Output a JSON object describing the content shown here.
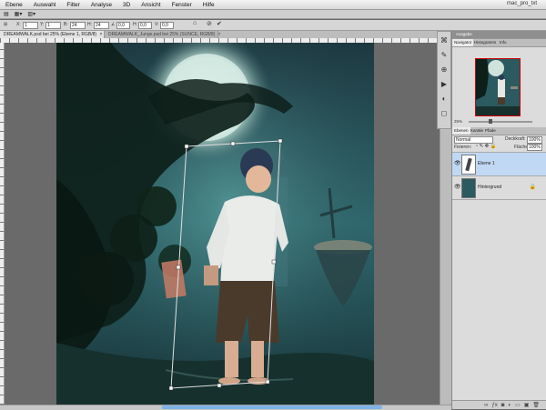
{
  "menu": {
    "items": [
      "Ebene",
      "Auswahl",
      "Filter",
      "Analyse",
      "3D",
      "Ansicht",
      "Fenster",
      "Hilfe"
    ],
    "workspace": "mac_pro_txt"
  },
  "options": {
    "field_w": "24",
    "field_h": "0,0",
    "field_x": "1",
    "field_angle": "0,0"
  },
  "tabs": [
    {
      "label": "DREAMWALK.psd bei 25% (Ebene 1, RGB/8)",
      "close": "×"
    },
    {
      "label": "DREAMWALK_Junge.psd bei 25% (SUNCE, RGB/8)",
      "close": "×"
    }
  ],
  "navigator": {
    "tabs": [
      "Navigator",
      "Histogramm",
      "Info"
    ],
    "header": "Ausgabe",
    "zoom": "25%"
  },
  "layers": {
    "tabs": [
      "Ebenen",
      "Kanäle",
      "Pfade"
    ],
    "blend_mode": "Normal",
    "opacity_label": "Deckkraft:",
    "opacity": "100%",
    "fill_label": "Fläche:",
    "fill": "100%",
    "lock_label": "Fixieren:",
    "rows": [
      {
        "name": "Ebene 1",
        "selected": true
      },
      {
        "name": "Hintergrund",
        "selected": false
      }
    ]
  },
  "icons": {
    "eye": "eye-icon",
    "lock": "lock-icon",
    "confirm": "check-icon",
    "cancel": "cancel-icon"
  },
  "colors": {
    "selection_blue": "#c0d8f4",
    "scroll_thumb": "#7fb2e8"
  }
}
